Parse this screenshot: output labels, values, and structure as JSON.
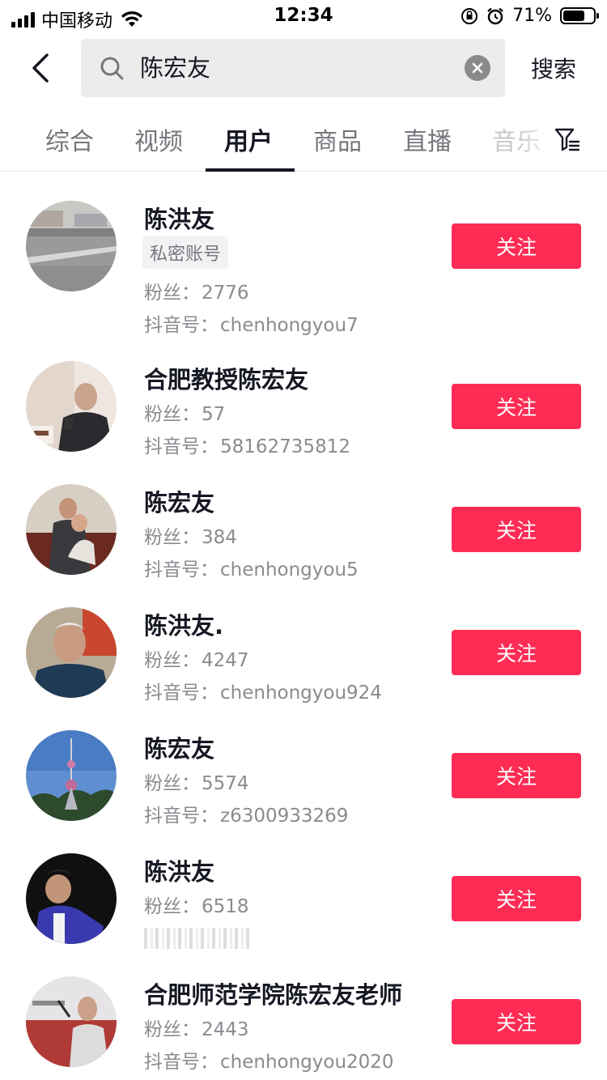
{
  "status_bar": {
    "carrier": "中国移动",
    "time": "12:34",
    "battery_percent": "71%",
    "battery_level": 0.71
  },
  "search": {
    "query": "陈宏友",
    "search_button_label": "搜索"
  },
  "tabs": [
    {
      "label": "综合",
      "active": false
    },
    {
      "label": "视频",
      "active": false
    },
    {
      "label": "用户",
      "active": true
    },
    {
      "label": "商品",
      "active": false
    },
    {
      "label": "直播",
      "active": false
    },
    {
      "label": "音乐",
      "active": false
    }
  ],
  "labels": {
    "followers": "粉丝：",
    "douyin_id": "抖音号："
  },
  "users": [
    {
      "name": "陈洪友",
      "tag": "私密账号",
      "followers": "2776",
      "douyin_id": "chenhongyou7",
      "follow_label": "关注"
    },
    {
      "name": "合肥教授陈宏友",
      "followers": "57",
      "douyin_id": "58162735812",
      "follow_label": "关注"
    },
    {
      "name": "陈宏友",
      "followers": "384",
      "douyin_id": "chenhongyou5",
      "follow_label": "关注"
    },
    {
      "name": "陈洪友.",
      "followers": "4247",
      "douyin_id": "chenhongyou924",
      "follow_label": "关注"
    },
    {
      "name": "陈宏友",
      "followers": "5574",
      "douyin_id": "z6300933269",
      "follow_label": "关注"
    },
    {
      "name": "陈洪友",
      "followers": "6518",
      "follow_label": "关注"
    },
    {
      "name": "合肥师范学院陈宏友老师",
      "followers": "2443",
      "douyin_id": "chenhongyou2020",
      "follow_label": "关注"
    }
  ],
  "colors": {
    "follow_button": "#fe2c55",
    "primary_text": "#161823",
    "secondary_text": "#8a8b90"
  }
}
